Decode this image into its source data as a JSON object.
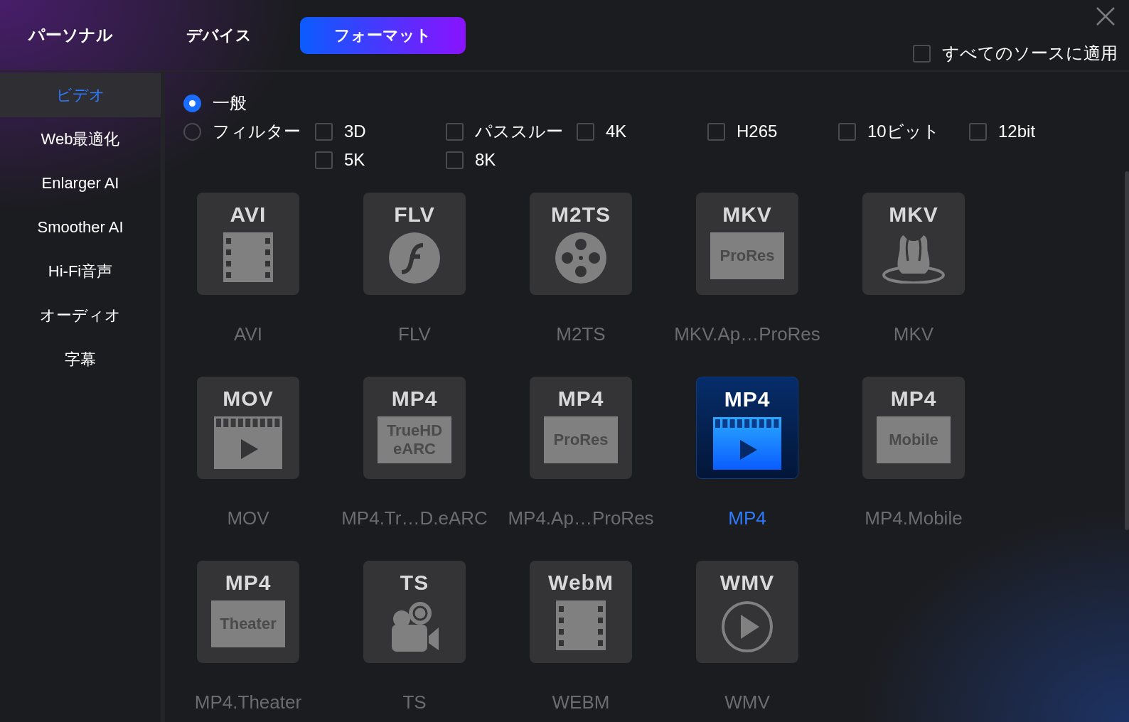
{
  "heading": "パーソナル",
  "top_tabs": [
    {
      "label": "デバイス",
      "selected": false
    },
    {
      "label": "フォーマット",
      "selected": true
    }
  ],
  "apply_all": {
    "label": "すべてのソースに適用",
    "checked": false
  },
  "sidebar": {
    "items": [
      {
        "label": "ビデオ",
        "selected": true
      },
      {
        "label": "Web最適化",
        "selected": false
      },
      {
        "label": "Enlarger AI",
        "selected": false
      },
      {
        "label": "Smoother AI",
        "selected": false
      },
      {
        "label": "Hi-Fi音声",
        "selected": false
      },
      {
        "label": "オーディオ",
        "selected": false
      },
      {
        "label": "字幕",
        "selected": false
      }
    ]
  },
  "modes": [
    {
      "label": "一般",
      "selected": true
    },
    {
      "label": "フィルター",
      "selected": false
    }
  ],
  "filters": [
    {
      "label": "3D",
      "checked": false
    },
    {
      "label": "パススルー",
      "checked": false
    },
    {
      "label": "4K",
      "checked": false
    },
    {
      "label": "H265",
      "checked": false
    },
    {
      "label": "10ビット",
      "checked": false
    },
    {
      "label": "12bit",
      "checked": false
    },
    {
      "label": "5K",
      "checked": false
    },
    {
      "label": "8K",
      "checked": false
    }
  ],
  "formats": [
    {
      "badge": "AVI",
      "kind": "film",
      "label": "AVI",
      "selected": false
    },
    {
      "badge": "FLV",
      "kind": "flash",
      "label": "FLV",
      "selected": false
    },
    {
      "badge": "M2TS",
      "kind": "reel",
      "label": "M2TS",
      "selected": false
    },
    {
      "badge": "MKV",
      "kind": "box",
      "box_lines": [
        "ProRes"
      ],
      "label": "MKV.Ap…ProRes",
      "selected": false
    },
    {
      "badge": "MKV",
      "kind": "mkv",
      "label": "MKV",
      "selected": false
    },
    {
      "badge": "MOV",
      "kind": "clapper",
      "label": "MOV",
      "selected": false
    },
    {
      "badge": "MP4",
      "kind": "box",
      "box_lines": [
        "TrueHD",
        "eARC"
      ],
      "label": "MP4.Tr…D.eARC",
      "selected": false
    },
    {
      "badge": "MP4",
      "kind": "box",
      "box_lines": [
        "ProRes"
      ],
      "label": "MP4.Ap…ProRes",
      "selected": false
    },
    {
      "badge": "MP4",
      "kind": "clapper",
      "label": "MP4",
      "selected": true
    },
    {
      "badge": "MP4",
      "kind": "box",
      "box_lines": [
        "Mobile"
      ],
      "label": "MP4.Mobile",
      "selected": false
    },
    {
      "badge": "MP4",
      "kind": "box",
      "box_lines": [
        "Theater"
      ],
      "label": "MP4.Theater",
      "selected": false
    },
    {
      "badge": "TS",
      "kind": "camera",
      "label": "TS",
      "selected": false
    },
    {
      "badge": "WebM",
      "kind": "film",
      "label": "WEBM",
      "selected": false
    },
    {
      "badge": "WMV",
      "kind": "play",
      "label": "WMV",
      "selected": false
    }
  ]
}
